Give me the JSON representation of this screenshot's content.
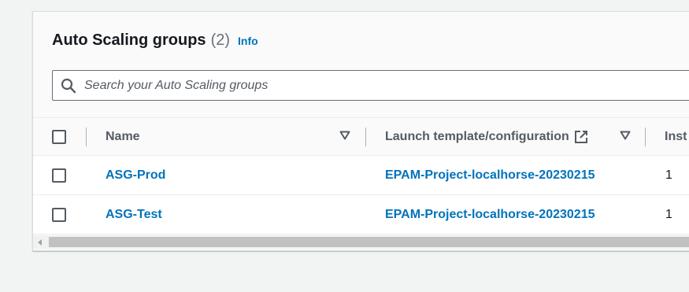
{
  "header": {
    "title": "Auto Scaling groups",
    "count": "(2)",
    "info_link": "Info"
  },
  "search": {
    "placeholder": "Search your Auto Scaling groups",
    "icon": "search-icon"
  },
  "table": {
    "columns": [
      "Name",
      "Launch template/configuration",
      "Inst"
    ],
    "rows": [
      {
        "name": "ASG-Prod",
        "launch_template": "EPAM-Project-localhorse-20230215",
        "instances": "1"
      },
      {
        "name": "ASG-Test",
        "launch_template": "EPAM-Project-localhorse-20230215",
        "instances": "1"
      }
    ]
  },
  "colors": {
    "link": "#0073bb",
    "header_text": "#545b64",
    "title_text": "#16191f",
    "count_text": "#687078"
  }
}
